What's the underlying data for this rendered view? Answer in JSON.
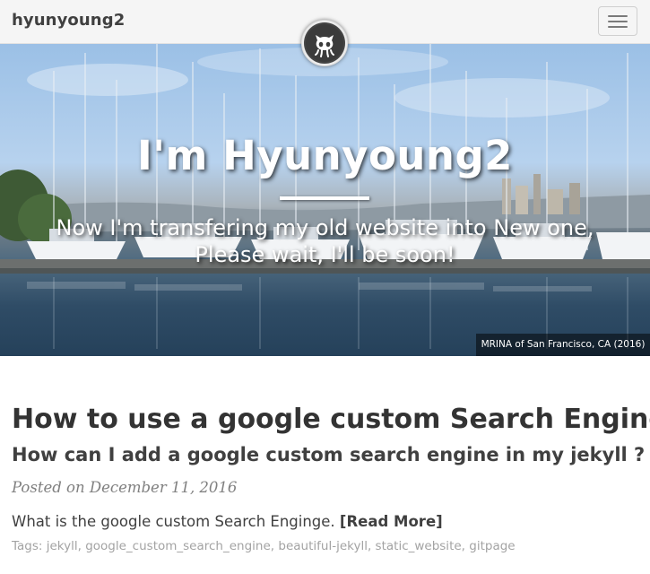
{
  "navbar": {
    "brand": "hyunyoung2",
    "toggle_icon": "hamburger-icon",
    "avatar_icon": "octocat-icon"
  },
  "hero": {
    "title": "I'm Hyunyoung2",
    "subtitle_line1": "Now I'm transfering my old website into New one,",
    "subtitle_line2": "Please wait, I'll be soon!",
    "caption": "MRINA of San Francisco, CA (2016)"
  },
  "post": {
    "title": "How to use a google custom Search Engine",
    "subtitle": "How can I add a google custom search engine in my jekyll ?",
    "meta": "Posted on December 11, 2016",
    "excerpt": "What is the google custom Search Enginge.",
    "read_more": "[Read More]",
    "tags_label": "Tags:",
    "tags": [
      "jekyll",
      "google_custom_search_engine",
      "beautiful-jekyll",
      "static_website",
      "gitpage"
    ]
  },
  "colors": {
    "navbar_bg": "#f5f5f5",
    "text": "#404040",
    "tag_text": "#a3a3a3",
    "meta_text": "#808080"
  }
}
